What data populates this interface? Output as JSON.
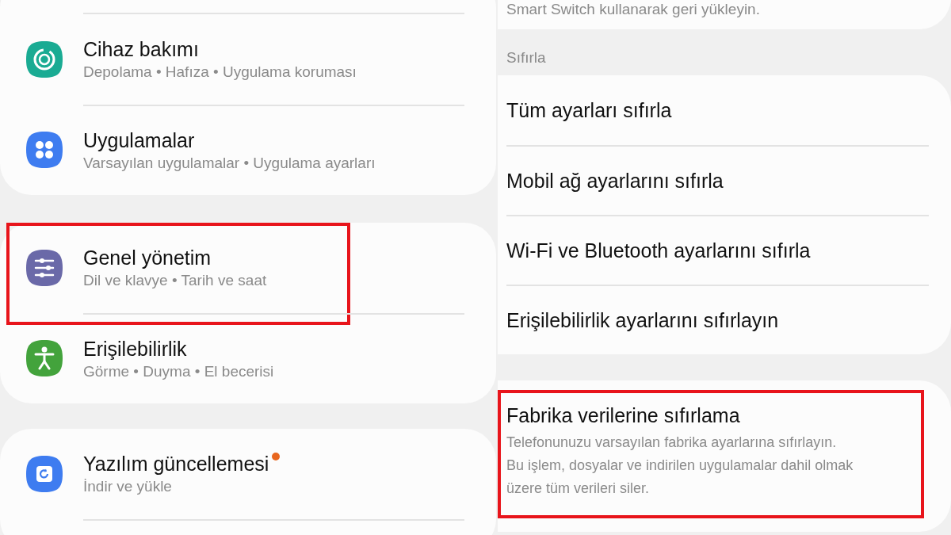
{
  "left_panel": {
    "groups": [
      {
        "continues_above": true,
        "continues_below": false,
        "items": [
          {
            "kind": "care",
            "title": "Cihaz bakımı",
            "subtitle": "Depolama • Hafıza • Uygulama koruması",
            "highlighted": false,
            "badge": false
          },
          {
            "kind": "apps",
            "title": "Uygulamalar",
            "subtitle": "Varsayılan uygulamalar • Uygulama ayarları",
            "highlighted": false,
            "badge": false
          }
        ]
      },
      {
        "continues_above": false,
        "continues_below": false,
        "items": [
          {
            "kind": "sliders",
            "title": "Genel yönetim",
            "subtitle": "Dil ve klavye • Tarih ve saat",
            "highlighted": true,
            "badge": false
          },
          {
            "kind": "accessibility",
            "title": "Erişilebilirlik",
            "subtitle": "Görme • Duyma • El becerisi",
            "highlighted": false,
            "badge": false
          }
        ]
      },
      {
        "continues_above": false,
        "continues_below": true,
        "items": [
          {
            "kind": "update",
            "title": "Yazılım güncellemesi",
            "subtitle": "İndir ve yükle",
            "highlighted": false,
            "badge": true
          }
        ]
      }
    ]
  },
  "right_panel": {
    "top_note": "Smart Switch kullanarak geri yükleyin.",
    "section_title": "Sıfırla",
    "reset_items": [
      "Tüm ayarları sıfırla",
      "Mobil ağ ayarlarını sıfırla",
      "Wi-Fi ve Bluetooth ayarlarını sıfırla",
      "Erişilebilirlik ayarlarını sıfırlayın"
    ],
    "factory_reset": {
      "title": "Fabrika verilerine sıfırlama",
      "description_lines": [
        "Telefonunuzu varsayılan fabrika ayarlarına sıfırlayın.",
        "Bu işlem, dosyalar ve indirilen uygulamalar dahil olmak",
        "üzere tüm verileri siler."
      ],
      "highlighted": true
    }
  }
}
